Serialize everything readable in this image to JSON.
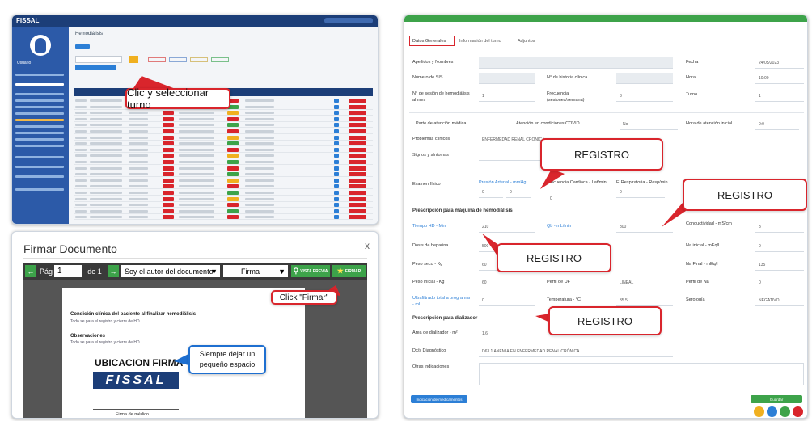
{
  "left_top": {
    "app_title": "FISSAL",
    "module_title": "Hemodiálisis",
    "user_name": "Usuario",
    "callout_turno": "Clic y seleccionar turno"
  },
  "left_bottom": {
    "dialog_title": "Firmar Documento",
    "close_label": "x",
    "page_label": "Pág",
    "page_value": "1",
    "page_total": "de 1",
    "author_select": "Soy el autor del documento",
    "sign_select": "Firma",
    "preview_button": "VISTA PREVIA",
    "sign_button": "FIRMAR",
    "callout_firmar": "Click \"Firmar\"",
    "doc_heading": "Condición clínica del paciente al finalizar hemodiálisis",
    "doc_subline": "Todo se para el registro y cierre de HD",
    "doc_obs_heading": "Observaciones",
    "doc_obs_line": "Todo se para el registro y cierre de HD",
    "ubicacion_firma": "UBICACION FIRMA",
    "logo_text": "FISSAL",
    "callout_espacio": "Siempre dejar un pequeño espacio",
    "firma_label": "Firma de médico"
  },
  "right": {
    "tabs": [
      "Datos Generales",
      "Información del turno",
      "Adjuntos"
    ],
    "fields": {
      "apellidos": "Apellidos y Nombres",
      "numero_sis": "Número de SIS",
      "n_historia": "N° de historia clínica",
      "n_sesion": "N° de sesión de hemodiálisis al mes",
      "frecuencia": "Frecuencia (sesiones/semana)",
      "fecha": "Fecha",
      "fecha_val": "24/05/2023",
      "hora": "Hora",
      "hora_val": "10:00",
      "turno": "Turno",
      "turno_val": "1",
      "sesion_val": "1",
      "frecuencia_val": "3"
    },
    "parte_header": "Parte de atención médica",
    "atencion_covid": "Atención en condiciones COVID",
    "atencion_covid_val": "No",
    "hora_atencion": "Hora de atención inicial",
    "problemas": "Problemas clínicos",
    "problemas_val": "ENFERMEDAD RENAL CRONICA",
    "signos": "Signos y síntomas",
    "examen": "Examen físico",
    "presion": "Presión Arterial - mmHg",
    "frecuencia_card": "Frecuencia Cardiaca - Lat/min",
    "frec_resp": "F. Respiratoria - Resp/min",
    "prescripcion_maquina": "Prescripción para máquina de hemodiálisis",
    "tiempo_hd": "Tiempo HD - Min",
    "qb": "Qb - mL/min",
    "conductividad": "Conductividad - mS/cm",
    "dosis_heparina": "Dosis de heparina",
    "na_inicial": "Na inicial - mEq/l",
    "peso_seco": "Peso seco - Kg",
    "na_final": "Na Final - mEq/l",
    "peso_inicial": "Peso inicial - Kg",
    "perfil_uf": "Perfil de UF",
    "perfil_uf_val": "LINEAL",
    "perfil_na": "Perfil de Na",
    "ultrafiltrado": "Ultrafiltrado total a programar - mL",
    "temperatura": "Temperatura - °C",
    "serologia": "Serología",
    "serologia_val": "NEGATIVO",
    "prescripcion_dializador": "Prescripción para dializador",
    "area_dializador": "Área de dializador - m²",
    "dx": "Dx/s Diagnóstico",
    "dx_val": "D63.1 ANEMIA EN ENFERMEDAD RENAL CRÓNICA",
    "otras": "Otras indicaciones",
    "btn_left": "Indicación de medicamentos",
    "btn_right": "Guardar",
    "registro": "REGISTRO",
    "values": {
      "tiempo": "210",
      "qb": "300",
      "conduct": "3",
      "hep": "500",
      "na_ini": "0",
      "peso_seco": "60",
      "na_fin": "135",
      "peso_ini": "60",
      "na_perfil": "0",
      "uf": "0",
      "temp": "35.5",
      "area": "1.6",
      "pa1": "0",
      "pa2": "0",
      "fc": "0",
      "fr": "0",
      "hora_at": "0:0"
    }
  },
  "colors": {
    "accent_red": "#d9252c",
    "blue": "#2c5aa8",
    "green": "#3da34a"
  }
}
